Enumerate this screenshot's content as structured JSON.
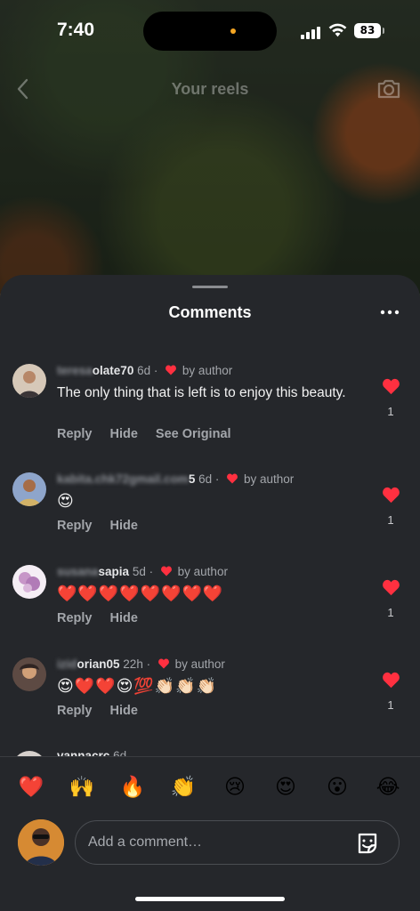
{
  "status_bar": {
    "time": "7:40",
    "battery": "83",
    "signal_icon": "cellular-signal-icon",
    "wifi_icon": "wifi-icon"
  },
  "header": {
    "title": "Your reels",
    "back_icon": "chevron-left-icon",
    "camera_icon": "camera-icon"
  },
  "sheet": {
    "title": "Comments",
    "more_icon": "more-horizontal-icon"
  },
  "comments": [
    {
      "username_blurred": "teresa",
      "username_visible": "olate70",
      "age": "6d",
      "separator": "·",
      "liked_by": "by author",
      "text": "The only thing that is left is to enjoy this beauty.",
      "actions": [
        "Reply",
        "Hide",
        "See Original"
      ],
      "likes": "1"
    },
    {
      "username_blurred": "kabita.chk72gmail.com",
      "username_visible": "5",
      "age": "6d",
      "separator": "·",
      "liked_by": "by author",
      "text": "😍",
      "actions": [
        "Reply",
        "Hide"
      ],
      "likes": "1"
    },
    {
      "username_blurred": "susana",
      "username_visible": "sapia",
      "age": "5d",
      "separator": "·",
      "liked_by": "by author",
      "text": "❤️❤️❤️❤️❤️❤️❤️❤️",
      "actions": [
        "Reply",
        "Hide"
      ],
      "likes": "1"
    },
    {
      "username_blurred": "izid",
      "username_visible": "orian05",
      "age": "22h",
      "separator": "·",
      "liked_by": "by author",
      "text": "😍❤️❤️😍💯👏🏻👏🏻👏🏻",
      "actions": [
        "Reply",
        "Hide"
      ],
      "likes": "1"
    }
  ],
  "partial_comment": {
    "username": "vannacrc",
    "age": "6d"
  },
  "reactions": [
    "❤️",
    "🙌",
    "🔥",
    "👏",
    "😢",
    "😍",
    "😮",
    "😂"
  ],
  "composer": {
    "placeholder": "Add a comment…",
    "sticker_icon": "sticker-icon",
    "avatar_icon": "profile-avatar"
  },
  "colors": {
    "sheet_bg": "#25272b",
    "accent_red": "#ff3040",
    "muted_text": "#a3a6ab"
  }
}
